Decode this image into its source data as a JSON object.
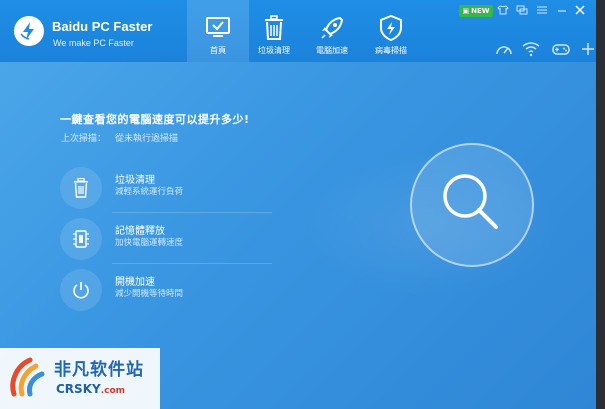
{
  "app": {
    "title": "Baidu PC Faster",
    "subtitle": "We make PC Faster"
  },
  "nav": {
    "tabs": [
      {
        "label": "首頁",
        "icon": "monitor-check-icon",
        "active": true
      },
      {
        "label": "垃圾清理",
        "icon": "trash-icon",
        "active": false
      },
      {
        "label": "電腦加速",
        "icon": "rocket-icon",
        "active": false
      },
      {
        "label": "病毒掃描",
        "icon": "shield-bolt-icon",
        "active": false
      }
    ]
  },
  "topbar": {
    "new_badge": "NEW"
  },
  "main": {
    "headline": "一鍵查看您的電腦速度可以提升多少!",
    "last_scan_label": "上次掃描：",
    "last_scan_value": "從未執行過掃描",
    "features": [
      {
        "title": "垃圾清理",
        "desc": "減輕系統運行負荷",
        "icon": "trash-icon"
      },
      {
        "title": "記憶體釋放",
        "desc": "加快電腦運轉速度",
        "icon": "memory-chip-icon"
      },
      {
        "title": "開機加速",
        "desc": "減少開機等待時間",
        "icon": "power-icon"
      }
    ]
  },
  "watermark": {
    "text": "非凡软件站",
    "sub": "CRSKY",
    "sub_suffix": ".com"
  },
  "colors": {
    "accent": "#1f8ee6",
    "background": "#3a97e2",
    "new_badge": "#35b84a"
  }
}
